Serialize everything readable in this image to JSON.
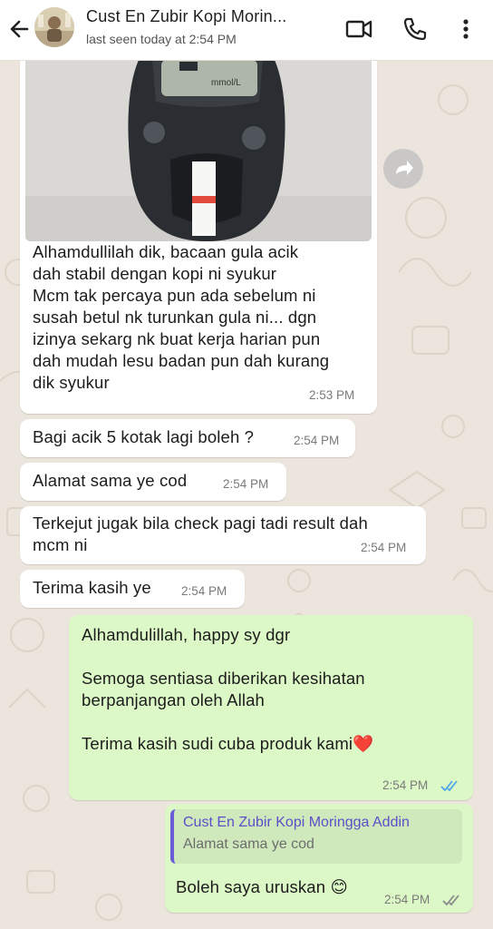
{
  "header": {
    "title": "Cust En Zubir Kopi Morin...",
    "status": "last seen today at 2:54 PM",
    "icons": [
      "back-arrow-icon",
      "video-call-icon",
      "voice-call-icon",
      "more-options-icon"
    ]
  },
  "photo": {
    "device_label": "mmol/L"
  },
  "messages": [
    {
      "text": "Alhamdullilah dik, bacaan gula acik\ndah stabil dengan kopi ni syukur\nMcm tak percaya pun ada sebelum ni\nsusah betul nk turunkan gula ni... dgn\nizinya sekarg nk buat kerja harian pun\ndah mudah lesu badan pun dah kurang\ndik syukur",
      "time": "2:53 PM"
    },
    {
      "text": "Bagi acik 5 kotak lagi boleh ?",
      "time": "2:54 PM"
    },
    {
      "text": "Alamat sama ye cod",
      "time": "2:54 PM"
    },
    {
      "text": "Terkejut jugak bila check pagi tadi result dah\nmcm ni",
      "time": "2:54 PM"
    },
    {
      "text": "Terima kasih ye",
      "time": "2:54 PM"
    },
    {
      "text": "Alhamdulillah, happy sy dgr\n\nSemoga sentiasa diberikan kesihatan\nberpanjangan oleh Allah\n\nTerima kasih sudi cuba produk kami❤️",
      "time": "2:54 PM"
    },
    {
      "text": "Boleh saya uruskan 😊",
      "time": "2:54 PM",
      "quote": {
        "name": "Cust En Zubir Kopi Moringga Addin",
        "text": "Alamat sama ye cod"
      }
    }
  ],
  "colors": {
    "incoming": "#ffffff",
    "outgoing": "#DCF8C6",
    "read_ticks": "#4fa9e6",
    "delivered_ticks": "#8a8a8a",
    "quote_bar": "#6b5bd6"
  }
}
